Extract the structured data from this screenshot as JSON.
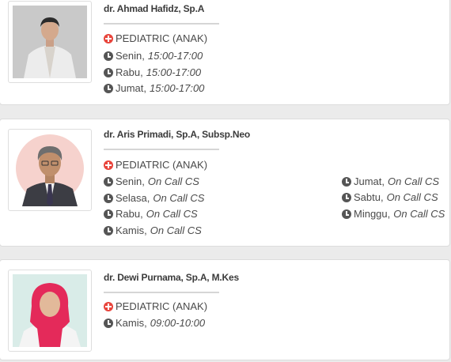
{
  "doctors": [
    {
      "name": "dr. Ahmad Hafidz, Sp.A",
      "specialty": "PEDIATRIC (ANAK)",
      "schedules": [
        {
          "day": "Senin,",
          "time": "15:00-17:00"
        },
        {
          "day": "Rabu,",
          "time": "15:00-17:00"
        },
        {
          "day": "Jumat,",
          "time": "15:00-17:00"
        }
      ]
    },
    {
      "name": "dr. Aris Primadi, Sp.A, Subsp.Neo",
      "specialty": "PEDIATRIC (ANAK)",
      "schedules": [
        {
          "day": "Senin,",
          "time": "On Call CS"
        },
        {
          "day": "Selasa,",
          "time": "On Call CS"
        },
        {
          "day": "Rabu,",
          "time": "On Call CS"
        },
        {
          "day": "Kamis,",
          "time": "On Call CS"
        },
        {
          "day": "Jumat,",
          "time": "On Call CS"
        },
        {
          "day": "Sabtu,",
          "time": "On Call CS"
        },
        {
          "day": "Minggu,",
          "time": "On Call CS"
        }
      ]
    },
    {
      "name": "dr. Dewi Purnama, Sp.A, M.Kes",
      "specialty": "PEDIATRIC (ANAK)",
      "schedules": [
        {
          "day": "Kamis,",
          "time": "09:00-10:00"
        }
      ]
    }
  ],
  "icons": {
    "specialty": "medical-cross-icon",
    "schedule": "clock-icon"
  },
  "colors": {
    "accent": "#e8453c",
    "text": "#4a4a4a",
    "card": "#ffffff",
    "background": "#ebebeb"
  }
}
